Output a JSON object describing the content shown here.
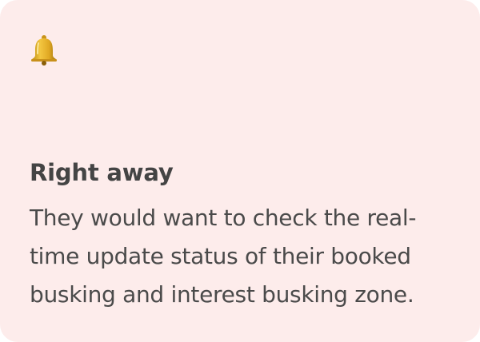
{
  "card": {
    "icon": "bell-icon",
    "title": "Right away",
    "description": "They would want to check the real-time update status of their booked busking and interest busking zone."
  },
  "colors": {
    "card_background": "#fdeceb",
    "heading": "#444444",
    "body": "#4a4a4a",
    "bell_gold": "#d9a21b"
  }
}
